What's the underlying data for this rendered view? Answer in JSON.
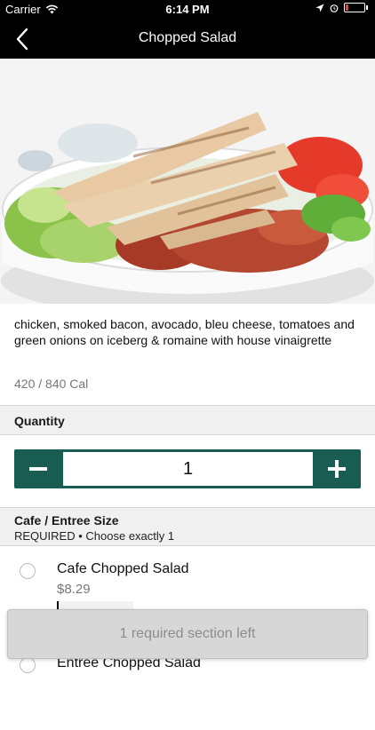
{
  "status_bar": {
    "carrier": "Carrier",
    "time": "6:14 PM"
  },
  "nav": {
    "title": "Chopped Salad",
    "back_icon": "chevron-left-icon"
  },
  "item": {
    "image_alt": "Chopped Salad",
    "description": "chicken, smoked bacon, avocado, bleu cheese, tomatoes and green onions on iceberg & romaine with house vinaigrette",
    "calories": "420 / 840 Cal"
  },
  "quantity": {
    "header": "Quantity",
    "value": "1",
    "minus_icon": "minus-icon",
    "plus_icon": "plus-icon"
  },
  "size_section": {
    "title": "Cafe / Entree Size",
    "subtitle": "REQUIRED • Choose exactly 1",
    "options": [
      {
        "name": "Cafe Chopped Salad",
        "price": "$8.29"
      },
      {
        "name": "Entree Chopped Salad",
        "price": ""
      }
    ]
  },
  "footer": {
    "required_label": "1 required section left"
  },
  "colors": {
    "accent": "#185c52",
    "header_bg": "#000000",
    "section_bg": "#f0f0f0"
  }
}
